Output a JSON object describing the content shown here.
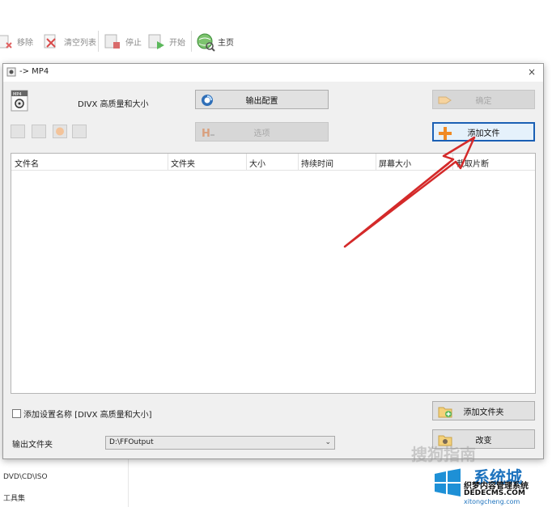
{
  "toolbar": {
    "items": [
      {
        "label": "移除",
        "icon": "remove-icon"
      },
      {
        "label": "清空列表",
        "icon": "clear-list-icon"
      },
      {
        "label": "停止",
        "icon": "stop-icon"
      },
      {
        "label": "开始",
        "icon": "start-icon"
      },
      {
        "label": "主页",
        "icon": "home-globe-icon"
      }
    ]
  },
  "sidebar": {
    "items": [
      "DVD\\CD\\ISO",
      "工具集"
    ]
  },
  "dialog": {
    "title": "-> MP4",
    "preset_label": "DIVX 高质量和大小",
    "output_config_label": "输出配置",
    "ok_label": "确定",
    "options_label": "选项",
    "add_file_label": "添加文件",
    "add_folder_label": "添加文件夹",
    "change_label": "改变",
    "add_setting_name_label": "添加设置名称 [DIVX 高质量和大小]",
    "output_folder_label": "输出文件夹",
    "output_folder_value": "D:\\FFOutput",
    "close_symbol": "×",
    "table_columns": [
      "文件名",
      "文件夹",
      "大小",
      "持续时间",
      "屏幕大小",
      "截取片断"
    ]
  },
  "watermark": {
    "text": "搜狗指南",
    "site_name": "系统城",
    "site_sub": "织梦内容管理系统",
    "site_url": "DEDECMS.COM",
    "site_domain": "xitongcheng.com"
  },
  "colors": {
    "arrow": "#d42a2a",
    "highlight_border": "#1a5fb4",
    "win_blue": "#1e90d6"
  }
}
